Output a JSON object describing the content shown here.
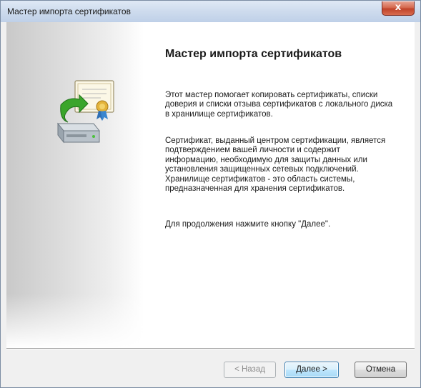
{
  "window": {
    "title": "Мастер импорта сертификатов",
    "close_glyph": "x"
  },
  "content": {
    "heading": "Мастер импорта сертификатов",
    "paragraph1": "Этот мастер помогает копировать сертификаты, списки доверия и списки отзыва сертификатов с локального диска в хранилище сертификатов.",
    "paragraph2": "Сертификат, выданный центром сертификации, является подтверждением вашей личности и содержит информацию, необходимую для защиты данных или установления защищенных сетевых подключений. Хранилище сертификатов - это область системы, предназначенная для хранения сертификатов.",
    "paragraph3": "Для продолжения нажмите кнопку \"Далее\"."
  },
  "buttons": {
    "back_label": "< Назад",
    "next_label": "Далее >",
    "cancel_label": "Отмена"
  },
  "icons": {
    "wizard": "certificate-import-icon"
  },
  "colors": {
    "close_button": "#c0432a",
    "default_button_border": "#3c7fb1",
    "arrow_green": "#3aa52b"
  }
}
